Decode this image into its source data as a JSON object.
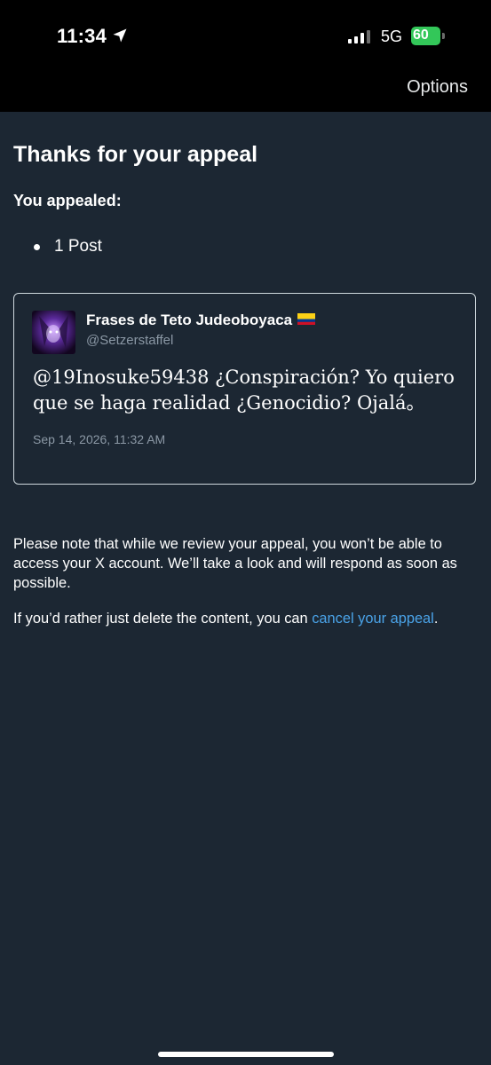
{
  "status_bar": {
    "time": "11:34",
    "network": "5G",
    "battery": "60",
    "location_icon": "location-arrow-icon",
    "signal_icon": "cellular-signal-icon",
    "battery_icon": "battery-charging-icon"
  },
  "header": {
    "options_label": "Options"
  },
  "page": {
    "title": "Thanks for your appeal",
    "appealed_label": "You appealed:",
    "appealed_items": [
      "1 Post"
    ]
  },
  "post": {
    "author_name": "Frases de Teto Judeoboyaca",
    "author_flag": "colombia-flag-icon",
    "author_handle": "@Setzerstaffel",
    "text": "@19Inosuke59438 ¿Conspiración? Yo quiero que se haga realidad ¿Genocidio? Ojalá。",
    "timestamp": "Sep 14, 2026, 11:32 AM"
  },
  "notice": {
    "review_text": "Please note that while we review your appeal, you won’t be able to access your X account. We’ll take a look and will respond as soon as possible.",
    "cancel_prefix": "If you’d rather just delete the content, you can ",
    "cancel_link": "cancel your appeal",
    "cancel_suffix": "."
  },
  "colors": {
    "background": "#1c2733",
    "link": "#4aa3e8",
    "battery": "#33c759",
    "muted": "#8b98a5"
  }
}
